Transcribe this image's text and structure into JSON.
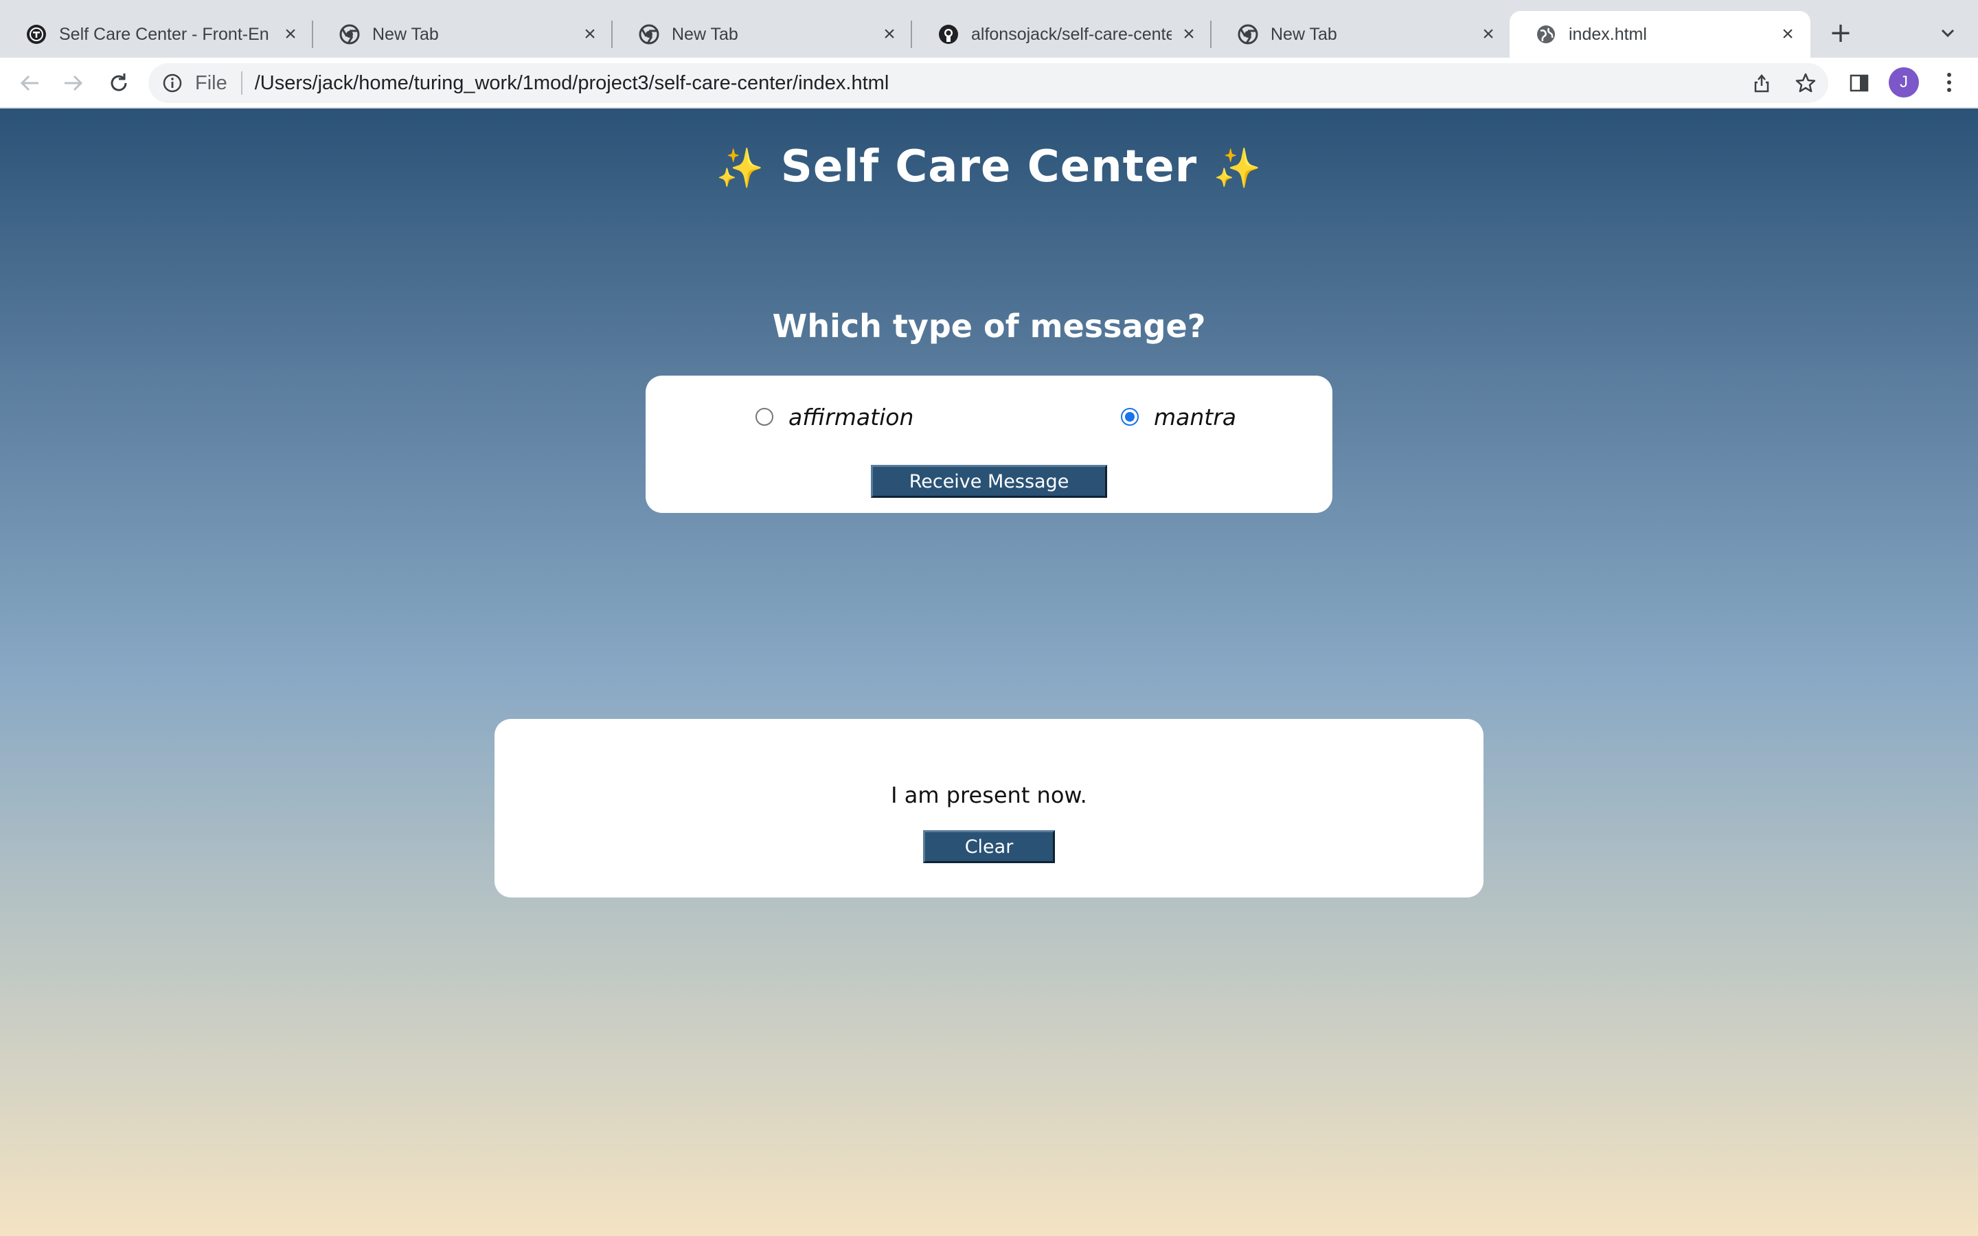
{
  "browser": {
    "tabs": [
      {
        "title": "Self Care Center - Front-En",
        "icon": "turing-icon",
        "active": false
      },
      {
        "title": "New Tab",
        "icon": "chrome-icon",
        "active": false
      },
      {
        "title": "New Tab",
        "icon": "chrome-icon",
        "active": false
      },
      {
        "title": "alfonsojack/self-care-cente",
        "icon": "github-icon",
        "active": false
      },
      {
        "title": "New Tab",
        "icon": "chrome-icon",
        "active": false
      },
      {
        "title": "index.html",
        "icon": "globe-icon",
        "active": true
      }
    ],
    "close_glyph": "×",
    "new_tab_glyph": "+",
    "address": {
      "scheme": "File",
      "url": "/Users/jack/home/turing_work/1mod/project3/self-care-center/index.html"
    },
    "profile_initial": "J",
    "profile_color": "#7b57c9"
  },
  "app": {
    "title_left": "✨",
    "title": "Self Care Center",
    "title_right": "✨",
    "question": "Which type of message?",
    "options": [
      {
        "label": "affirmation",
        "checked": false
      },
      {
        "label": "mantra",
        "checked": true
      }
    ],
    "receive_button": "Receive Message",
    "message": "I am present now.",
    "clear_button": "Clear",
    "colors": {
      "gradient_top": "#2b5377",
      "gradient_bottom": "#f4e3c3",
      "button": "#2a5275",
      "radio_checked": "#1a73e8"
    }
  }
}
